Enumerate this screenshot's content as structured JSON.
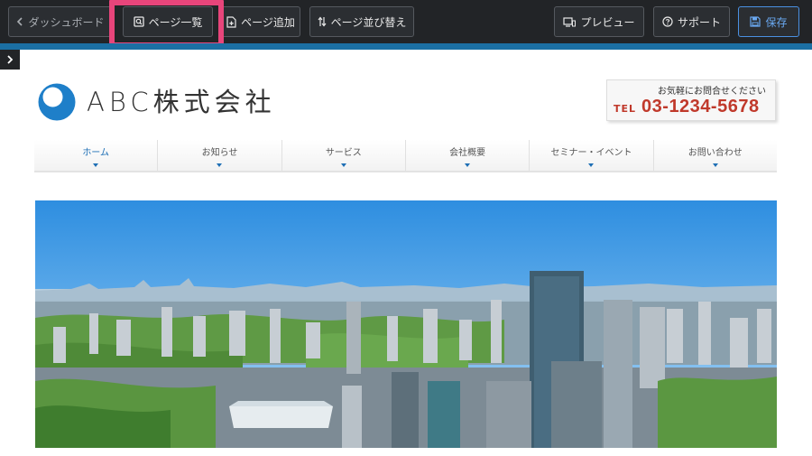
{
  "toolbar": {
    "dashboard_label": "ダッシュボード",
    "page_list_label": "ページ一覧",
    "add_page_label": "ページ追加",
    "reorder_label": "ページ並び替え",
    "preview_label": "プレビュー",
    "support_label": "サポート",
    "save_label": "保存"
  },
  "colors": {
    "toolbar_bg": "#222427",
    "highlight": "#e8457b",
    "accent_blue": "#1e6fb5",
    "tel_red": "#c0392b"
  },
  "site": {
    "company_name": "ABC株式会社",
    "contact": {
      "note": "お気軽にお問合せください",
      "tel_label": "TEL",
      "tel_number": "03-1234-5678"
    },
    "nav": [
      {
        "label": "ホーム",
        "active": true
      },
      {
        "label": "お知らせ",
        "active": false
      },
      {
        "label": "サービス",
        "active": false
      },
      {
        "label": "会社概要",
        "active": false
      },
      {
        "label": "セミナー・イベント",
        "active": false
      },
      {
        "label": "お問い合わせ",
        "active": false
      }
    ]
  },
  "icons": {
    "dashboard": "chevron-left-icon",
    "page_list": "search-page-icon",
    "add_page": "page-plus-icon",
    "reorder": "sort-icon",
    "preview": "monitor-phone-icon",
    "support": "question-circle-icon",
    "save": "floppy-disk-icon",
    "side_toggle": "chevron-right-icon"
  }
}
